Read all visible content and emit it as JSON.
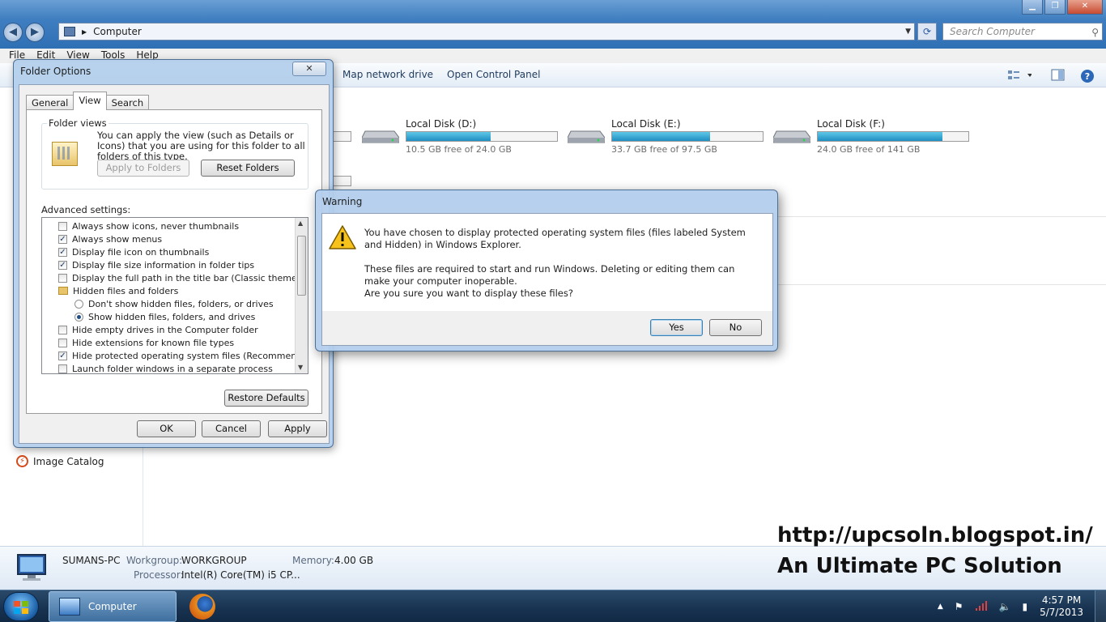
{
  "explorer": {
    "address_text": "Computer",
    "search_placeholder": "Search Computer",
    "menu": [
      "File",
      "Edit",
      "View",
      "Tools",
      "Help"
    ],
    "toolbar": {
      "map_network_drive": "Map network drive",
      "open_control_panel": "Open Control Panel"
    },
    "drives": [
      {
        "name": "Local Disk (D:)",
        "free_text": "10.5 GB free of 24.0 GB",
        "used_fraction": 0.56
      },
      {
        "name": "Local Disk (E:)",
        "free_text": "33.7 GB free of 97.5 GB",
        "used_fraction": 0.65
      },
      {
        "name": "Local Disk (F:)",
        "free_text": "24.0 GB free of 141 GB",
        "used_fraction": 0.83
      }
    ],
    "image_catalog": "Image Catalog",
    "details": {
      "computer_name": "SUMANS-PC",
      "workgroup_label": "Workgroup:",
      "workgroup_value": "WORKGROUP",
      "memory_label": "Memory:",
      "memory_value": "4.00 GB",
      "processor_label": "Processor:",
      "processor_value": "Intel(R) Core(TM) i5 CP..."
    }
  },
  "watermark": {
    "line1": "http://upcsoln.blogspot.in/",
    "line2": "An Ultimate PC Solution"
  },
  "folder_options": {
    "title": "Folder Options",
    "close_glyph": "✕",
    "tabs": [
      "General",
      "View",
      "Search"
    ],
    "active_tab": "View",
    "folder_views": {
      "legend": "Folder views",
      "description": "You can apply the view (such as Details or Icons) that you are using for this folder to all folders of this type.",
      "apply_button": "Apply to Folders",
      "reset_button": "Reset Folders"
    },
    "advanced_label": "Advanced settings:",
    "settings": [
      {
        "type": "checkbox",
        "checked": false,
        "label": "Always show icons, never thumbnails"
      },
      {
        "type": "checkbox",
        "checked": true,
        "label": "Always show menus"
      },
      {
        "type": "checkbox",
        "checked": true,
        "label": "Display file icon on thumbnails"
      },
      {
        "type": "checkbox",
        "checked": true,
        "label": "Display file size information in folder tips"
      },
      {
        "type": "checkbox",
        "checked": false,
        "label": "Display the full path in the title bar (Classic theme only)"
      },
      {
        "type": "folder",
        "label": "Hidden files and folders"
      },
      {
        "type": "radio",
        "checked": false,
        "label": "Don't show hidden files, folders, or drives"
      },
      {
        "type": "radio",
        "checked": true,
        "label": "Show hidden files, folders, and drives"
      },
      {
        "type": "checkbox",
        "checked": false,
        "label": "Hide empty drives in the Computer folder"
      },
      {
        "type": "checkbox",
        "checked": false,
        "label": "Hide extensions for known file types"
      },
      {
        "type": "checkbox",
        "checked": true,
        "label": "Hide protected operating system files (Recommended)"
      },
      {
        "type": "checkbox",
        "checked": false,
        "label": "Launch folder windows in a separate process"
      }
    ],
    "restore_defaults": "Restore Defaults",
    "ok": "OK",
    "cancel": "Cancel",
    "apply": "Apply"
  },
  "warning": {
    "title": "Warning",
    "paragraph1": "You have chosen to display protected operating system files (files labeled System and Hidden) in Windows Explorer.",
    "paragraph2": "These files are required to start and run Windows. Deleting or editing them can make your computer inoperable.",
    "paragraph3": "Are you sure you want to display these files?",
    "yes": "Yes",
    "no": "No"
  },
  "taskbar": {
    "active_task_label": "Computer",
    "time": "4:57 PM",
    "date": "5/7/2013"
  },
  "colors": {
    "progress_fill": "#1f8fc2",
    "accent": "#3f7ec0"
  }
}
